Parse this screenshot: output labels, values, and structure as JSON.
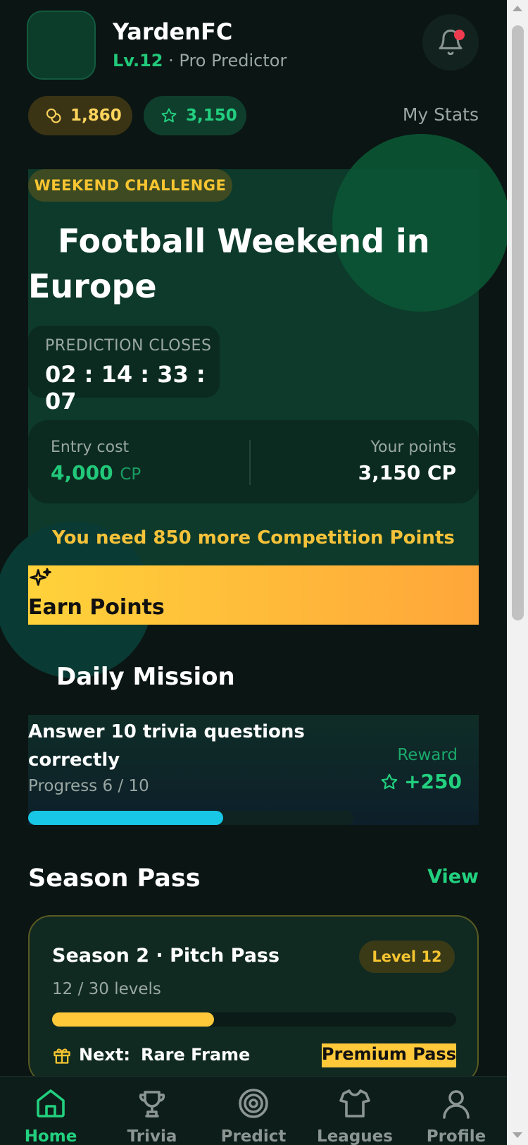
{
  "user": {
    "name": "YardenFC",
    "level": "Lv.12",
    "title": "· Pro Predictor"
  },
  "wallet": {
    "coins": "1,860",
    "stars": "3,150",
    "my_stats_label": "My Stats"
  },
  "challenge": {
    "tag": "WEEKEND CHALLENGE",
    "title": "Football Weekend in Europe",
    "closes_label": "PREDICTION CLOSES",
    "countdown": "02 : 14 : 33 : 07",
    "entry_cost_label": "Entry cost",
    "entry_cost_value": "4,000",
    "entry_cost_unit": "CP",
    "your_points_label": "Your points",
    "your_points_value": "3,150 CP",
    "need_text": "You need 850 more Competition Points",
    "earn_button_label": "Earn Points"
  },
  "daily_mission": {
    "section_title": "Daily Mission",
    "text": "Answer 10 trivia questions correctly",
    "progress_label": "Progress 6 / 10",
    "progress": 0.6,
    "reward_label": "Reward",
    "reward_value": "+250"
  },
  "season_pass": {
    "section_title": "Season Pass",
    "view_label": "View",
    "name": "Season 2 · Pitch Pass",
    "level_badge": "Level 12",
    "levels_text": "12 / 30 levels",
    "progress": 0.4,
    "next_label": "Next:",
    "next_item": "Rare Frame",
    "premium_label": "Premium Pass"
  },
  "nav": {
    "items": [
      {
        "label": "Home",
        "icon": "home-icon",
        "active": true
      },
      {
        "label": "Trivia",
        "icon": "trophy-icon",
        "active": false
      },
      {
        "label": "Predict",
        "icon": "target-icon",
        "active": false
      },
      {
        "label": "Leagues",
        "icon": "shirt-icon",
        "active": false
      },
      {
        "label": "Profile",
        "icon": "user-icon",
        "active": false
      }
    ]
  },
  "colors": {
    "accent_green": "#22d07f",
    "gold": "#f7c531",
    "cyan": "#18c7e6",
    "notification_red": "#ef3b4f"
  }
}
